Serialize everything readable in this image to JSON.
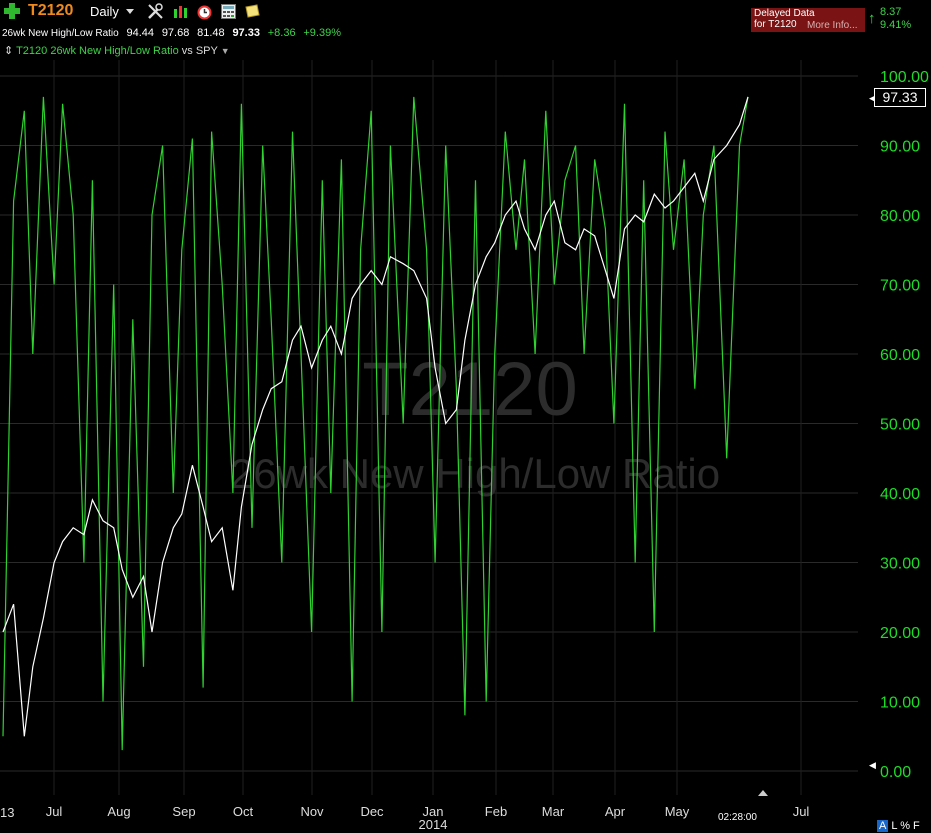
{
  "header": {
    "symbol": "T2120",
    "period": "Daily",
    "indicator_name": "26wk New High/Low Ratio",
    "open": "94.44",
    "high": "97.68",
    "low": "81.48",
    "close": "97.33",
    "change": "+8.36",
    "change_pct": "+9.39%",
    "comparison_label": "T2120 26wk New High/Low Ratio",
    "comparison_vs": "vs SPY",
    "delayed_line1": "Delayed Data",
    "delayed_line2": "for T2120",
    "more_info": "More Info...",
    "side_change": "8.37",
    "side_pct": "9.41%"
  },
  "chart": {
    "last_value": "97.33",
    "time": "02:28:00",
    "modes": {
      "a": "A",
      "l": "L",
      "pct": "%",
      "f": "F"
    },
    "year_label": "2014",
    "edge_label": "13"
  },
  "chart_data": {
    "type": "line",
    "title": "T2120",
    "subtitle": "26wk New High/Low Ratio",
    "ylim": [
      0,
      100
    ],
    "yticks": [
      "0.00",
      "10.00",
      "20.00",
      "30.00",
      "40.00",
      "50.00",
      "60.00",
      "70.00",
      "80.00",
      "90.00",
      "100.00"
    ],
    "xticks": [
      "Jul",
      "Aug",
      "Sep",
      "Oct",
      "Nov",
      "Dec",
      "Jan",
      "Feb",
      "Mar",
      "Apr",
      "May",
      "Jul"
    ],
    "grid": true,
    "colors": {
      "ratio": "#2fd22f",
      "spy": "#ffffff",
      "axis_text": "#1fdc2a"
    },
    "series": [
      {
        "name": "T2120",
        "x": [
          "2013-06-21",
          "2013-06-26",
          "2013-07-01",
          "2013-07-05",
          "2013-07-10",
          "2013-07-15",
          "2013-07-19",
          "2013-07-24",
          "2013-07-29",
          "2013-08-02",
          "2013-08-07",
          "2013-08-12",
          "2013-08-16",
          "2013-08-21",
          "2013-08-26",
          "2013-08-30",
          "2013-09-04",
          "2013-09-09",
          "2013-09-13",
          "2013-09-18",
          "2013-09-23",
          "2013-09-27",
          "2013-10-02",
          "2013-10-07",
          "2013-10-11",
          "2013-10-16",
          "2013-10-21",
          "2013-10-25",
          "2013-10-30",
          "2013-11-04",
          "2013-11-08",
          "2013-11-13",
          "2013-11-18",
          "2013-11-22",
          "2013-11-27",
          "2013-12-02",
          "2013-12-06",
          "2013-12-11",
          "2013-12-16",
          "2013-12-20",
          "2013-12-26",
          "2013-12-31",
          "2014-01-06",
          "2014-01-10",
          "2014-01-15",
          "2014-01-20",
          "2014-01-24",
          "2014-01-29",
          "2014-02-03",
          "2014-02-07",
          "2014-02-12",
          "2014-02-17",
          "2014-02-21",
          "2014-02-26",
          "2014-03-03",
          "2014-03-07",
          "2014-03-12",
          "2014-03-17",
          "2014-03-21",
          "2014-03-26",
          "2014-03-31",
          "2014-04-04",
          "2014-04-09",
          "2014-04-14",
          "2014-04-18",
          "2014-04-23",
          "2014-04-28",
          "2014-05-02",
          "2014-05-07",
          "2014-05-12",
          "2014-05-16",
          "2014-05-21",
          "2014-05-27",
          "2014-06-02",
          "2014-06-06"
        ],
        "values": [
          5,
          82,
          95,
          60,
          97,
          70,
          96,
          80,
          30,
          85,
          10,
          70,
          3,
          65,
          15,
          80,
          90,
          40,
          75,
          91,
          12,
          92,
          70,
          40,
          96,
          35,
          90,
          65,
          30,
          92,
          60,
          20,
          85,
          40,
          88,
          10,
          75,
          95,
          20,
          90,
          50,
          97,
          75,
          30,
          90,
          55,
          8,
          85,
          10,
          60,
          92,
          75,
          88,
          60,
          95,
          70,
          85,
          90,
          60,
          88,
          78,
          50,
          96,
          30,
          85,
          20,
          92,
          75,
          88,
          55,
          80,
          90,
          45,
          90,
          97
        ]
      },
      {
        "name": "SPY",
        "x": [
          "2013-06-21",
          "2013-06-26",
          "2013-07-01",
          "2013-07-05",
          "2013-07-10",
          "2013-07-15",
          "2013-07-19",
          "2013-07-24",
          "2013-07-29",
          "2013-08-02",
          "2013-08-07",
          "2013-08-12",
          "2013-08-16",
          "2013-08-21",
          "2013-08-26",
          "2013-08-30",
          "2013-09-04",
          "2013-09-09",
          "2013-09-13",
          "2013-09-18",
          "2013-09-23",
          "2013-09-27",
          "2013-10-02",
          "2013-10-07",
          "2013-10-11",
          "2013-10-16",
          "2013-10-21",
          "2013-10-25",
          "2013-10-30",
          "2013-11-04",
          "2013-11-08",
          "2013-11-13",
          "2013-11-18",
          "2013-11-22",
          "2013-11-27",
          "2013-12-02",
          "2013-12-06",
          "2013-12-11",
          "2013-12-16",
          "2013-12-20",
          "2013-12-26",
          "2013-12-31",
          "2014-01-06",
          "2014-01-10",
          "2014-01-15",
          "2014-01-20",
          "2014-01-24",
          "2014-01-29",
          "2014-02-03",
          "2014-02-07",
          "2014-02-12",
          "2014-02-17",
          "2014-02-21",
          "2014-02-26",
          "2014-03-03",
          "2014-03-07",
          "2014-03-12",
          "2014-03-17",
          "2014-03-21",
          "2014-03-26",
          "2014-03-31",
          "2014-04-04",
          "2014-04-09",
          "2014-04-14",
          "2014-04-18",
          "2014-04-23",
          "2014-04-28",
          "2014-05-02",
          "2014-05-07",
          "2014-05-12",
          "2014-05-16",
          "2014-05-21",
          "2014-05-27",
          "2014-06-02",
          "2014-06-06"
        ],
        "values": [
          20,
          24,
          5,
          15,
          22,
          30,
          33,
          35,
          34,
          39,
          36,
          35,
          29,
          25,
          28,
          20,
          30,
          35,
          37,
          44,
          38,
          33,
          35,
          26,
          38,
          47,
          52,
          55,
          56,
          62,
          64,
          58,
          62,
          64,
          60,
          68,
          70,
          72,
          70,
          74,
          73,
          72,
          68,
          58,
          50,
          52,
          62,
          70,
          74,
          76,
          80,
          82,
          78,
          75,
          80,
          82,
          76,
          75,
          78,
          77,
          72,
          68,
          78,
          80,
          79,
          83,
          81,
          82,
          84,
          86,
          82,
          88,
          90,
          93,
          97
        ]
      }
    ]
  }
}
